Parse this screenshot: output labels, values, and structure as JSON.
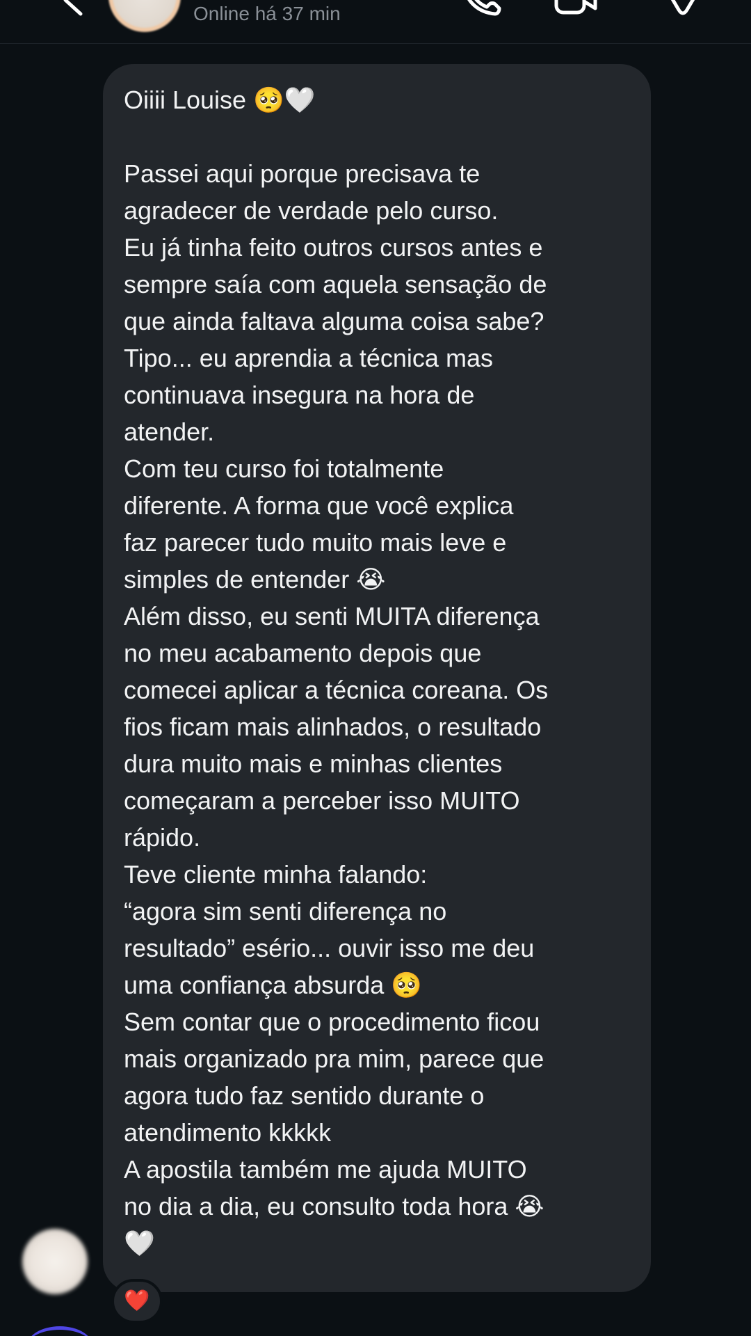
{
  "header": {
    "status": "Online há 37 min",
    "icons": [
      "chevron-left-icon",
      "phone-icon",
      "video-camera-icon",
      "flag-icon"
    ]
  },
  "message": {
    "lines": [
      "Oiiii Louise 🥺🤍",
      "",
      "Passei aqui porque precisava te",
      "agradecer de verdade pelo curso.",
      "Eu já tinha feito outros cursos antes e",
      "sempre saía com aquela sensação de",
      "que ainda faltava alguma coisa sabe?",
      "Tipo... eu aprendia a técnica mas",
      "continuava insegura na hora de",
      "atender.",
      "Com teu curso foi totalmente",
      "diferente. A forma que você explica",
      "faz parecer tudo muito mais leve e",
      "simples de entender 😭",
      "Além disso, eu senti MUITA diferença",
      "no meu acabamento depois que",
      "comecei aplicar a técnica coreana. Os",
      "fios ficam mais alinhados, o resultado",
      "dura muito mais e minhas clientes",
      "começaram a perceber isso MUITO",
      "rápido.",
      "Teve cliente minha falando:",
      "“agora sim senti diferença no",
      "resultado” esério... ouvir isso me deu",
      "uma confiança absurda 🥺",
      "Sem contar que o procedimento ficou",
      "mais organizado pra mim, parece que",
      "agora tudo faz sentido durante o",
      "atendimento kkkkk",
      "A apostila também me ajuda MUITO",
      "no dia a dia, eu consulto toda hora 😭",
      "🤍"
    ]
  },
  "reaction": {
    "emoji": "❤️"
  },
  "colors": {
    "background": "#0b1014",
    "bubble": "#23272c",
    "text": "#f2f3f4",
    "status_text": "#8a9097"
  }
}
